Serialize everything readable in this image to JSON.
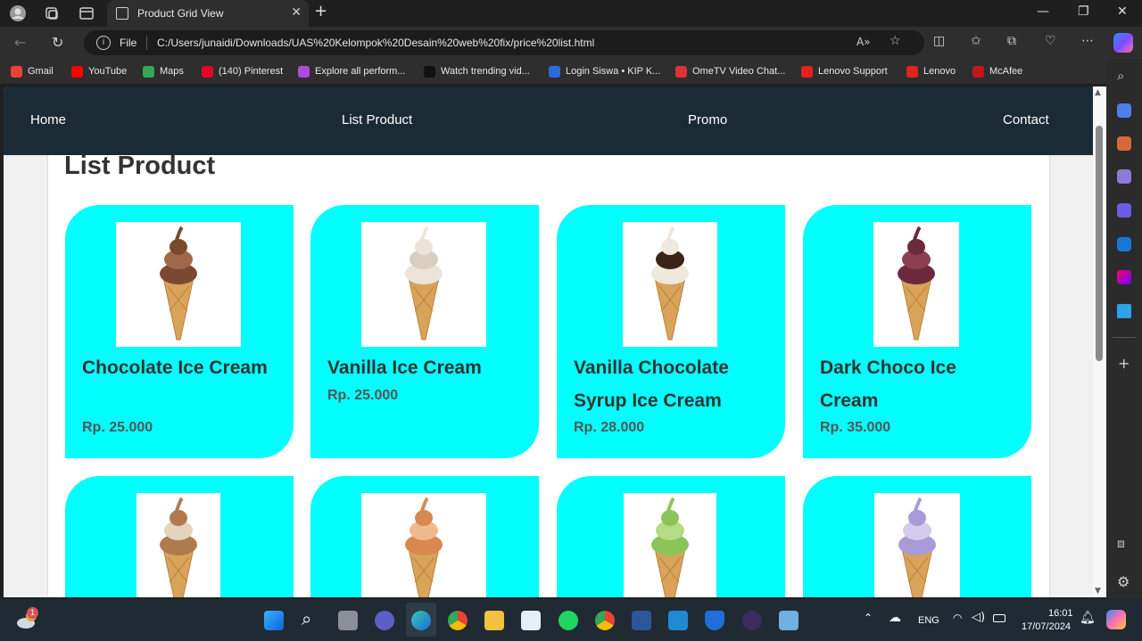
{
  "browser": {
    "tab_title": "Product Grid View",
    "tab_close": "✕",
    "new_tab": "+",
    "file_label": "File",
    "url": "C:/Users/junaidi/Downloads/UAS%20Kelompok%20Desain%20web%20fix/price%20list.html",
    "win_min": "—",
    "win_max": "❐",
    "win_close": "✕",
    "bookmarks": [
      {
        "label": "Gmail",
        "color": "#ea4335"
      },
      {
        "label": "YouTube",
        "color": "#ff0000"
      },
      {
        "label": "Maps",
        "color": "#34a853"
      },
      {
        "label": "(140) Pinterest",
        "color": "#e60023"
      },
      {
        "label": "Explore all perform...",
        "color": "#b04ad8"
      },
      {
        "label": "Watch trending vid...",
        "color": "#111111"
      },
      {
        "label": "Login Siswa • KIP K...",
        "color": "#2d6bd8"
      },
      {
        "label": "OmeTV Video Chat...",
        "color": "#d33"
      },
      {
        "label": "Lenovo Support",
        "color": "#e2231a"
      },
      {
        "label": "Lenovo",
        "color": "#e2231a"
      },
      {
        "label": "McAfee",
        "color": "#c01818"
      }
    ]
  },
  "site": {
    "nav": {
      "home": "Home",
      "list_product": "List Product",
      "promo": "Promo",
      "contact": "Contact"
    },
    "heading": "List Product",
    "products": [
      {
        "name": "Chocolate Ice Cream",
        "price": "Rp. 25.000",
        "scoop": "#7a4a30",
        "scoop2": "#a0684a"
      },
      {
        "name": "Vanilla Ice Cream",
        "price": "Rp. 25.000",
        "scoop": "#ece4d8",
        "scoop2": "#d9cdbd"
      },
      {
        "name": "Vanilla Chocolate Syrup Ice Cream",
        "price": "Rp. 28.000",
        "scoop": "#efe8dc",
        "scoop2": "#3a2418"
      },
      {
        "name": "Dark Choco Ice Cream",
        "price": "Rp. 35.000",
        "scoop": "#6b2b3c",
        "scoop2": "#8c3f52"
      },
      {
        "name": "",
        "price": "",
        "scoop": "#b07a4f",
        "scoop2": "#e6d3bd"
      },
      {
        "name": "",
        "price": "",
        "scoop": "#d98850",
        "scoop2": "#efb98c"
      },
      {
        "name": "",
        "price": "",
        "scoop": "#8cc45a",
        "scoop2": "#b4dc84"
      },
      {
        "name": "",
        "price": "",
        "scoop": "#a99ad8",
        "scoop2": "#d4cbee"
      }
    ]
  },
  "taskbar": {
    "weather_badge": "1",
    "lang": "ENG",
    "time": "16:01",
    "date": "17/07/2024"
  }
}
